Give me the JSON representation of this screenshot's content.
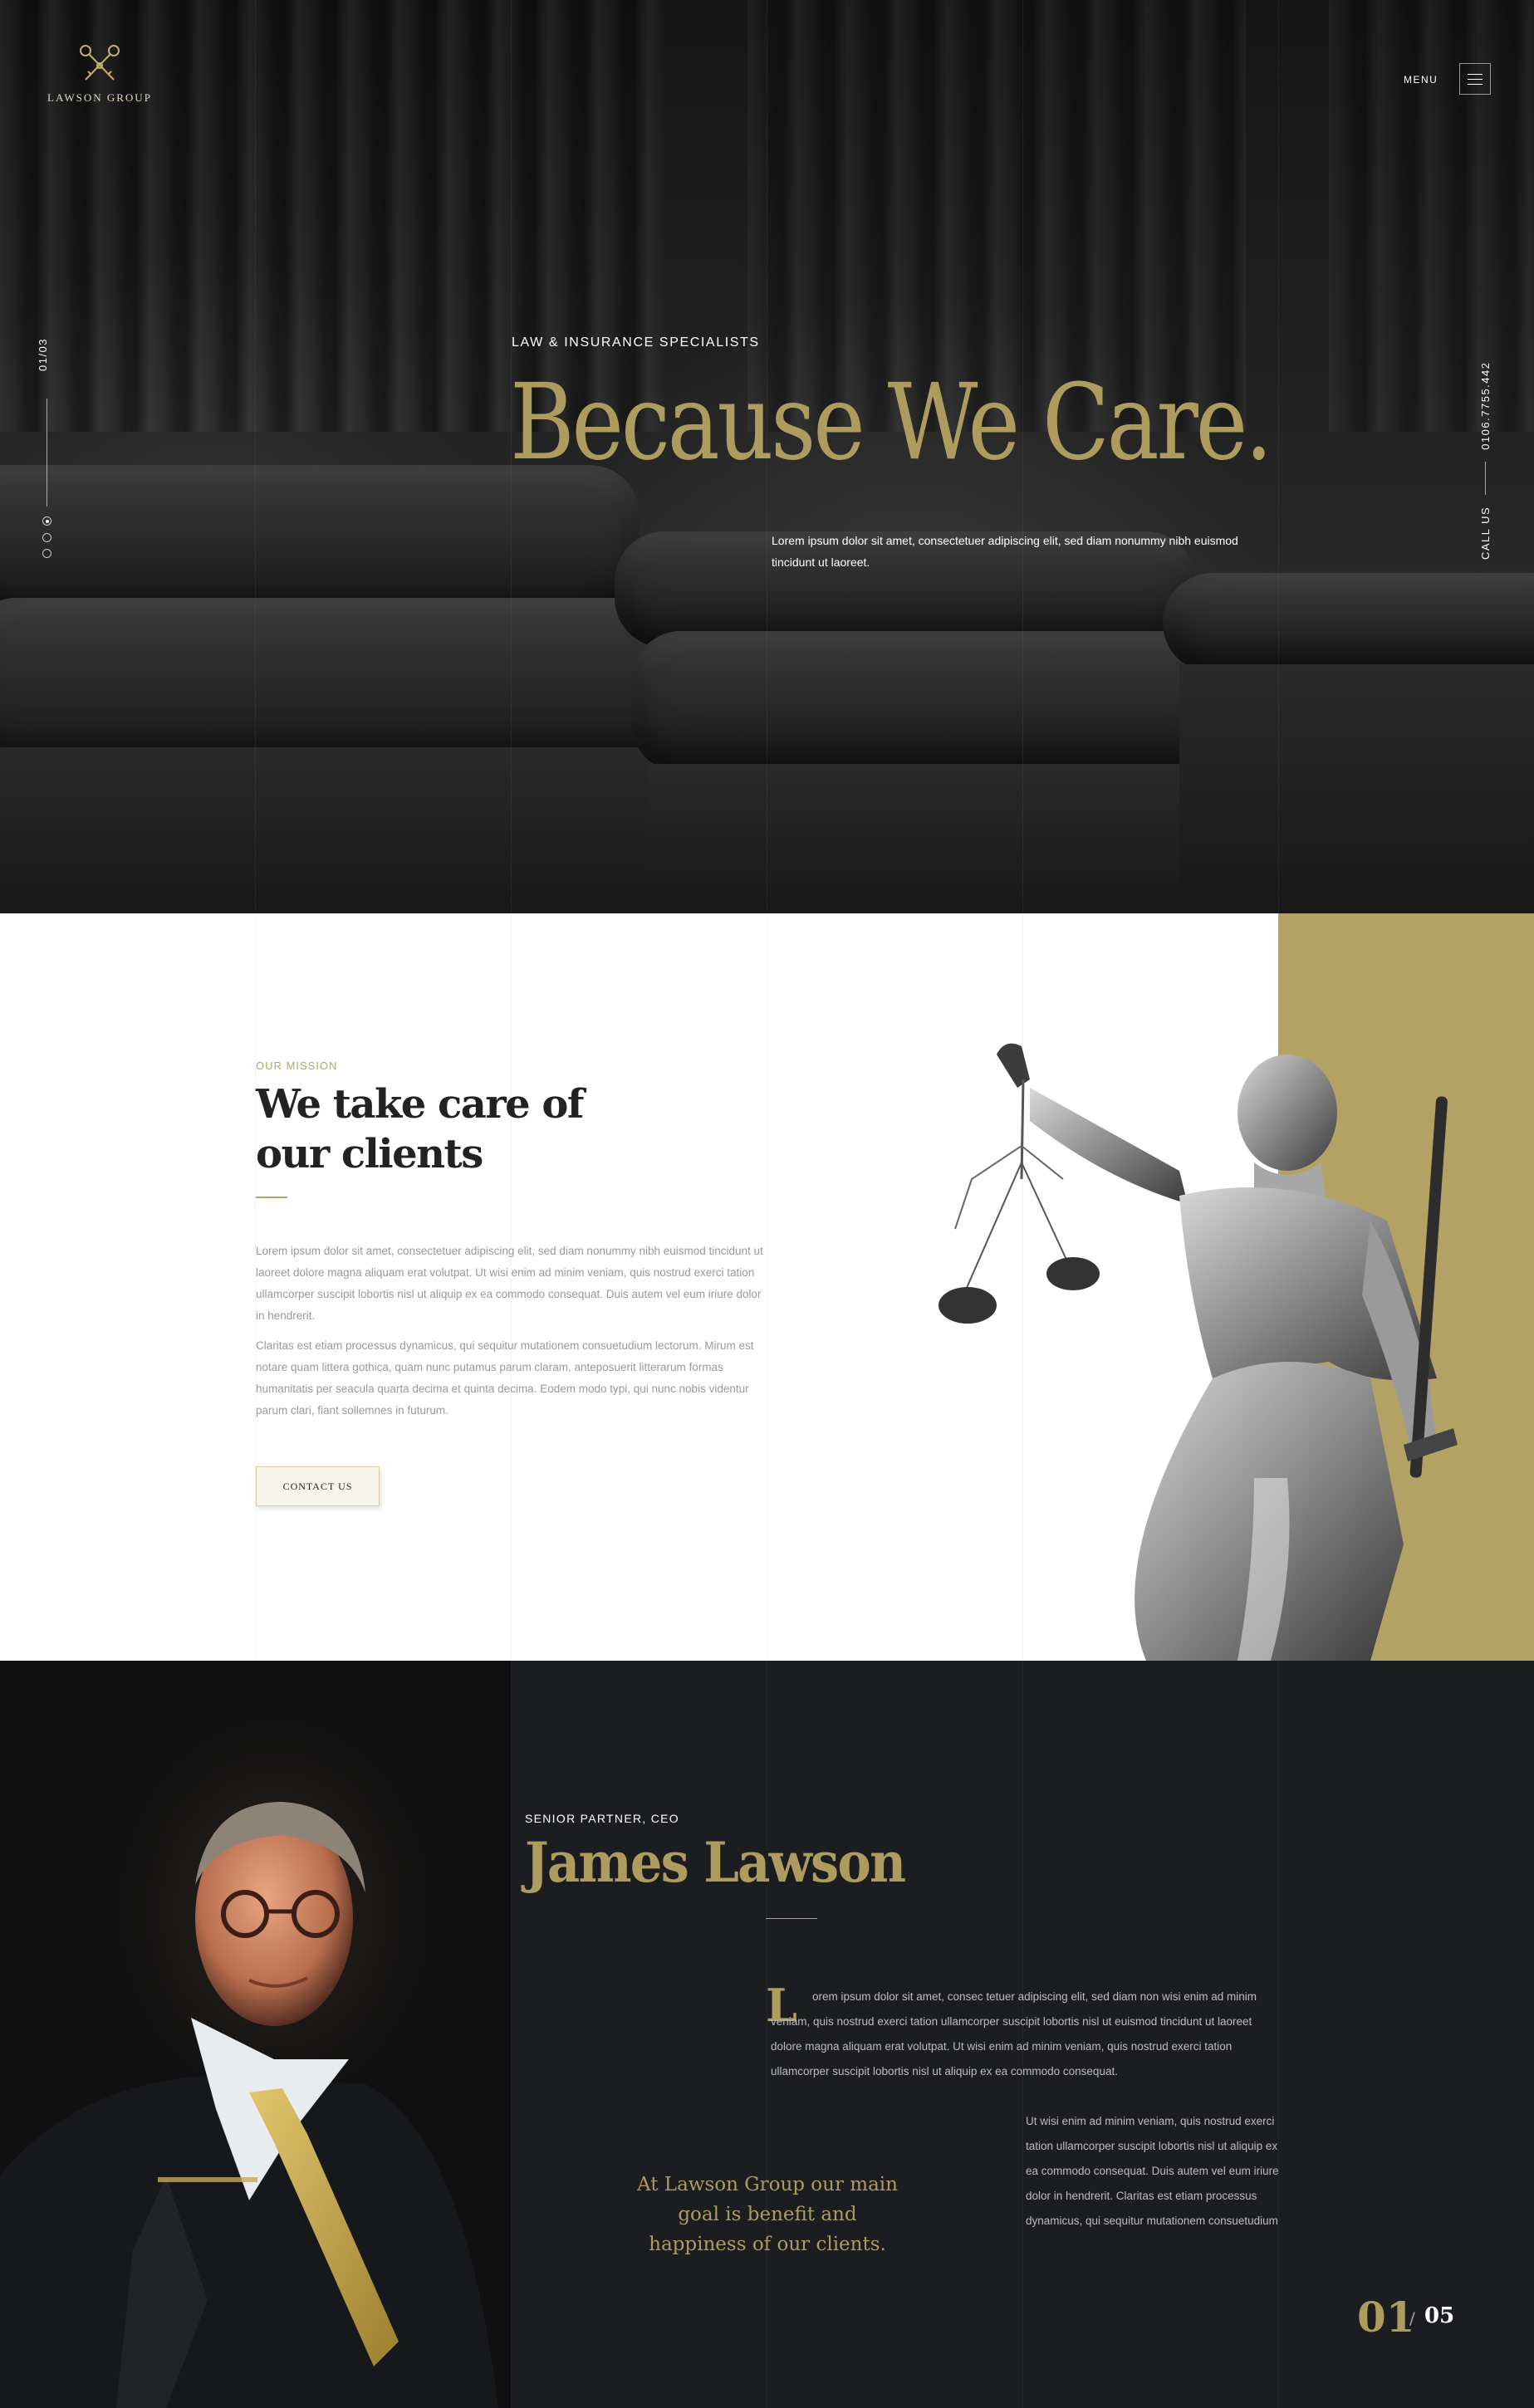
{
  "brand": {
    "name": "LAWSON GROUP",
    "accent": "#ae9b5e",
    "gold_panel": "#b4a164",
    "dark_bg": "#1c1d20",
    "logo_icon": "crossed-keys-icon"
  },
  "nav": {
    "menu_label": "MENU",
    "menu_icon": "hamburger-icon"
  },
  "hero": {
    "slide_counter": "01/03",
    "dots": [
      "active",
      "inactive",
      "inactive"
    ],
    "eyebrow": "LAW & INSURANCE SPECIALISTS",
    "title": "Because We Care.",
    "text": "Lorem ipsum dolor sit amet, consectetuer adipiscing elit, sed diam nonummy nibh euismod tincidunt ut laoreet.",
    "call_label": "CALL US",
    "phone": "0106.7755.442"
  },
  "mission": {
    "eyebrow": "OUR MISSION",
    "title_line1": "We take care of",
    "title_line2": "our clients",
    "paragraph1": "Lorem ipsum dolor sit amet, consectetuer adipiscing elit, sed diam nonummy nibh euismod tincidunt ut laoreet dolore magna aliquam erat volutpat. Ut wisi enim ad minim veniam, quis nostrud exerci tation ullamcorper suscipit lobortis nisl ut aliquip ex ea commodo consequat. Duis autem vel eum iriure dolor in hendrerit.",
    "paragraph2": "Claritas est etiam processus dynamicus, qui sequitur mutationem consuetudium lectorum. Mirum est notare quam littera gothica, quam nunc putamus parum claram, anteposuerit litterarum formas humanitatis per seacula quarta decima et quinta decima. Eodem modo typi, qui nunc nobis videntur parum clari, fiant sollemnes in futurum.",
    "button_label": "CONTACT US",
    "image": "lady-justice-statue"
  },
  "partner": {
    "eyebrow": "SENIOR PARTNER, CEO",
    "name": "James Lawson",
    "dropcap": "L",
    "paragraph1": "orem ipsum dolor sit amet, consec tetuer adipiscing elit, sed diam non wisi enim ad minim veniam, quis nostrud exerci tation ullamcorper suscipit lobortis nisl ut euismod tincidunt ut laoreet dolore magna aliquam erat volutpat. Ut wisi enim ad minim veniam, quis nostrud exerci tation ullamcorper suscipit lobortis nisl ut aliquip ex ea commodo consequat.",
    "paragraph2": "Ut wisi enim ad minim veniam, quis nostrud exerci tation ullamcorper suscipit lobortis nisl ut aliquip ex ea commodo consequat. Duis autem vel eum iriure dolor in hendrerit. Claritas est etiam processus dynamicus, qui sequitur mutationem consuetudium",
    "quote": "At Lawson Group our main goal is benefit and happiness of our clients.",
    "page_current": "01",
    "page_separator": "/",
    "page_total": "05",
    "image": "ceo-portrait"
  }
}
